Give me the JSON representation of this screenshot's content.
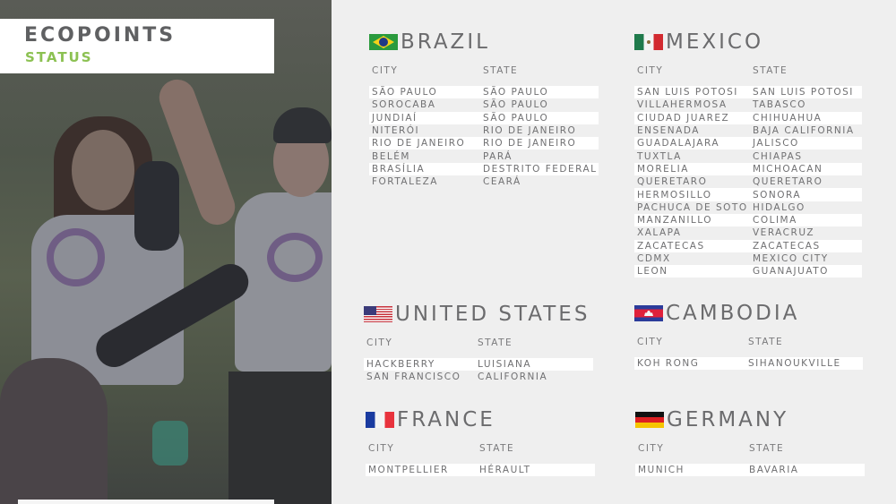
{
  "header": {
    "title": "ECOPOINTS",
    "subtitle": "STATUS"
  },
  "colors": {
    "accent_green": "#8cc152",
    "title_gray": "#5f6062",
    "background": "#efefef",
    "stripe": "#ffffff"
  },
  "columns": {
    "city": "CITY",
    "state": "STATE"
  },
  "countries": {
    "brazil": {
      "name": "BRAZIL",
      "flag_icon": "brazil-flag-icon",
      "rows": [
        {
          "city": "SÃO PAULO",
          "state": "SÃO PAULO"
        },
        {
          "city": "SOROCABA",
          "state": "SÃO PAULO"
        },
        {
          "city": "JUNDIAÍ",
          "state": "SÃO PAULO"
        },
        {
          "city": "NITERÓI",
          "state": "RIO DE JANEIRO"
        },
        {
          "city": "RIO DE JANEIRO",
          "state": "RIO DE JANEIRO"
        },
        {
          "city": "BELÉM",
          "state": "PARÁ"
        },
        {
          "city": "BRASÍLIA",
          "state": "DESTRITO FEDERAL"
        },
        {
          "city": "FORTALEZA",
          "state": "CEARÁ"
        }
      ]
    },
    "mexico": {
      "name": "MEXICO",
      "flag_icon": "mexico-flag-icon",
      "rows": [
        {
          "city": "SAN LUIS POTOSI",
          "state": "SAN LUIS POTOSI"
        },
        {
          "city": "VILLAHERMOSA",
          "state": "TABASCO"
        },
        {
          "city": "CIUDAD JUAREZ",
          "state": "CHIHUAHUA"
        },
        {
          "city": "ENSENADA",
          "state": "BAJA CALIFORNIA"
        },
        {
          "city": "GUADALAJARA",
          "state": "JALISCO"
        },
        {
          "city": "TUXTLA",
          "state": "CHIAPAS"
        },
        {
          "city": "MORELIA",
          "state": "MICHOACAN"
        },
        {
          "city": "QUERETARO",
          "state": "QUERETARO"
        },
        {
          "city": "HERMOSILLO",
          "state": "SONORA"
        },
        {
          "city": "PACHUCA DE SOTO",
          "state": "HIDALGO"
        },
        {
          "city": "MANZANILLO",
          "state": "COLIMA"
        },
        {
          "city": "XALAPA",
          "state": "VERACRUZ"
        },
        {
          "city": "ZACATECAS",
          "state": "ZACATECAS"
        },
        {
          "city": "CDMX",
          "state": "MEXICO CITY"
        },
        {
          "city": "LEON",
          "state": "GUANAJUATO"
        }
      ]
    },
    "united_states": {
      "name": "UNITED STATES",
      "flag_icon": "usa-flag-icon",
      "rows": [
        {
          "city": "HACKBERRY",
          "state": "LUISIANA"
        },
        {
          "city": "SAN FRANCISCO",
          "state": "CALIFORNIA"
        }
      ]
    },
    "cambodia": {
      "name": "CAMBODIA",
      "flag_icon": "cambodia-flag-icon",
      "rows": [
        {
          "city": "KOH RONG",
          "state": "SIHANOUKVILLE"
        }
      ]
    },
    "france": {
      "name": "FRANCE",
      "flag_icon": "france-flag-icon",
      "rows": [
        {
          "city": "MONTPELLIER",
          "state": "HÉRAULT"
        }
      ]
    },
    "germany": {
      "name": "GERMANY",
      "flag_icon": "germany-flag-icon",
      "rows": [
        {
          "city": "MUNICH",
          "state": "BAVARIA"
        }
      ]
    }
  }
}
